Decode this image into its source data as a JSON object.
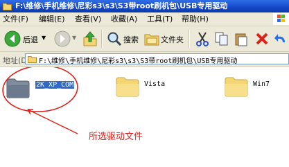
{
  "window": {
    "title": "F:\\维修\\手机维修\\尼彩s3\\s3\\S3带root刷机包\\USB专用驱动"
  },
  "menubar": {
    "items": [
      "文件(F)",
      "编辑(E)",
      "查看(V)",
      "收藏(A)",
      "工具(T)",
      "帮助(H)"
    ]
  },
  "toolbar": {
    "back_label": "后退",
    "search_label": "搜索",
    "folders_label": "文件夹"
  },
  "addressbar": {
    "label": "地址(D)",
    "path": "F:\\维修\\手机维修\\尼彩s3\\s3\\S3带root刷机包\\USB专用驱动"
  },
  "folders": [
    {
      "name": "2K_XP_COM",
      "selected": true
    },
    {
      "name": "Vista",
      "selected": false
    },
    {
      "name": "Win7",
      "selected": false
    }
  ],
  "annotation": {
    "text": "所选驱动文件",
    "color": "#e0201a"
  },
  "colors": {
    "titlebar": "#1448c8",
    "selection": "#316ac5",
    "folder": "#f4d774"
  }
}
